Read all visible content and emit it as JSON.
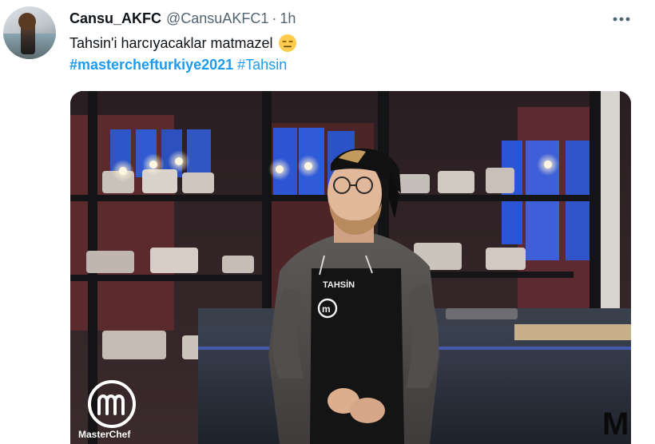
{
  "tweet": {
    "display_name": "Cansu_AKFC",
    "handle": "@CansuAKFC1",
    "separator": "·",
    "time": "1h",
    "text": "Tahsin'i harcıyacaklar matmazel",
    "emoji": "expressionless-face-icon",
    "hashtags": [
      "#masterchefturkiye2021",
      "#Tahsin"
    ],
    "more_icon": "more-dots-icon"
  },
  "media": {
    "apron_name": "TAHSİN",
    "logo_text": "MasterChef"
  },
  "colors": {
    "link": "#1d9bf0",
    "secondary_text": "#536471",
    "primary_text": "#0f1419"
  }
}
